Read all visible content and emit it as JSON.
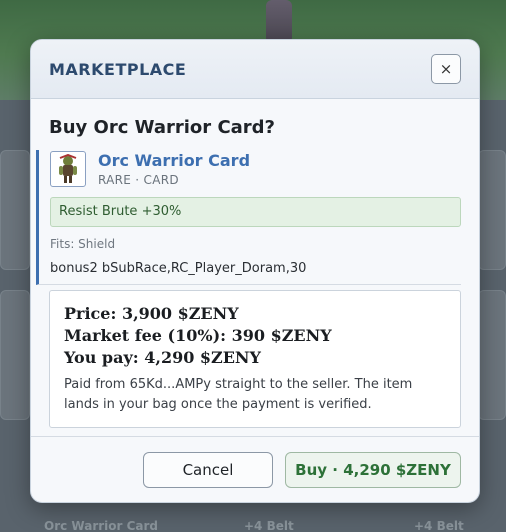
{
  "background": {
    "cards": [
      {
        "label": "Orc Warrior Card"
      },
      {
        "label": "+4 Belt"
      },
      {
        "label": "+4 Belt"
      }
    ]
  },
  "modal": {
    "title": "MARKETPLACE",
    "close_label": "×",
    "question": "Buy Orc Warrior Card?",
    "item": {
      "name": "Orc Warrior Card",
      "meta": "RARE · CARD",
      "effect": "Resist Brute +30%",
      "fits": "Fits: Shield",
      "script": "bonus2 bSubRace,RC_Player_Doram,30",
      "icon": "orc-warrior-card-icon"
    },
    "pricing": {
      "price": "Price: 3,900 $ZENY",
      "fee": "Market fee (10%): 390 $ZENY",
      "pay": "You pay: 4,290 $ZENY",
      "note": "Paid from 65Kd...AMPy straight to the seller. The item lands in your bag once the payment is verified."
    },
    "footer": {
      "cancel_label": "Cancel",
      "buy_label": "Buy · 4,290 $ZENY"
    }
  },
  "colors": {
    "accent": "#3d6fb0",
    "effect_bg": "#e4f1e4",
    "buy_text": "#2d7138"
  }
}
